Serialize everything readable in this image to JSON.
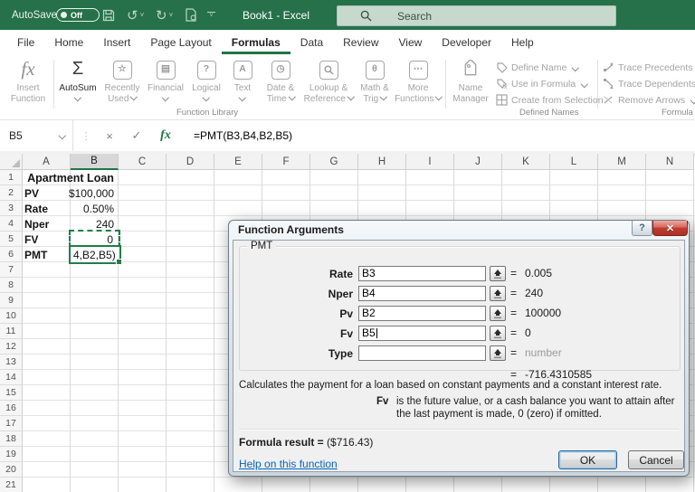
{
  "titlebar": {
    "autosave_label": "AutoSave",
    "autosave_state": "Off",
    "doc_title": "Book1 - Excel",
    "search_placeholder": "Search"
  },
  "tabs": {
    "file": "File",
    "home": "Home",
    "insert": "Insert",
    "page_layout": "Page Layout",
    "formulas": "Formulas",
    "data": "Data",
    "review": "Review",
    "view": "View",
    "developer": "Developer",
    "help": "Help"
  },
  "ribbon": {
    "function_library": {
      "group_label": "Function Library",
      "insert_function": {
        "l1": "Insert",
        "l2": "Function"
      },
      "autosum": "AutoSum",
      "recently_used": {
        "l1": "Recently",
        "l2": "Used"
      },
      "financial": "Financial",
      "logical": "Logical",
      "text": "Text",
      "date_time": {
        "l1": "Date &",
        "l2": "Time"
      },
      "lookup_reference": {
        "l1": "Lookup &",
        "l2": "Reference"
      },
      "math_trig": {
        "l1": "Math &",
        "l2": "Trig"
      },
      "more_functions": {
        "l1": "More",
        "l2": "Functions"
      }
    },
    "defined_names": {
      "group_label": "Defined Names",
      "name_manager": {
        "l1": "Name",
        "l2": "Manager"
      },
      "define_name": "Define Name",
      "use_in_formula": "Use in Formula",
      "create_from_selection": "Create from Selection"
    },
    "formula_auditing": {
      "group_label": "Formula Auditing",
      "trace_precedents": "Trace Precedents",
      "trace_dependents": "Trace Dependents",
      "remove_arrows": "Remove Arrows"
    }
  },
  "formula_bar": {
    "name_box": "B5",
    "formula": "=PMT(B3,B4,B2,B5)"
  },
  "sheet": {
    "columns": [
      "A",
      "B",
      "C",
      "D",
      "E",
      "F",
      "G",
      "H",
      "I",
      "J",
      "K",
      "L",
      "M",
      "N"
    ],
    "row_count": 21,
    "title_cell": "Apartment Loan",
    "data_rows": [
      {
        "label": "PV",
        "value": "$100,000"
      },
      {
        "label": "Rate",
        "value": "0.50%"
      },
      {
        "label": "Nper",
        "value": "240"
      },
      {
        "label": "FV",
        "value": "0"
      },
      {
        "label": "PMT",
        "value": "4,B2,B5)"
      }
    ]
  },
  "dialog": {
    "title": "Function Arguments",
    "function_name": "PMT",
    "equals_sign": "=",
    "args": [
      {
        "name": "Rate",
        "value": "B3",
        "result": "0.005"
      },
      {
        "name": "Nper",
        "value": "B4",
        "result": "240"
      },
      {
        "name": "Pv",
        "value": "B2",
        "result": "100000"
      },
      {
        "name": "Fv",
        "value": "B5",
        "result": "0"
      },
      {
        "name": "Type",
        "value": "",
        "result": "number"
      }
    ],
    "overall_result": "-716.4310585",
    "description": "Calculates the payment for a loan based on constant payments and a constant interest rate.",
    "arg_help_name": "Fv",
    "arg_help_text": "is the future value, or a cash balance you want to attain after the last payment is made, 0 (zero) if omitted.",
    "formula_result_label": "Formula result = ",
    "formula_result_value": "($716.43)",
    "help_link": "Help on this function",
    "ok": "OK",
    "cancel": "Cancel"
  },
  "colors": {
    "excel_green": "#217346",
    "ants_green": "#1e7e4a",
    "link_blue": "#0563c1"
  }
}
